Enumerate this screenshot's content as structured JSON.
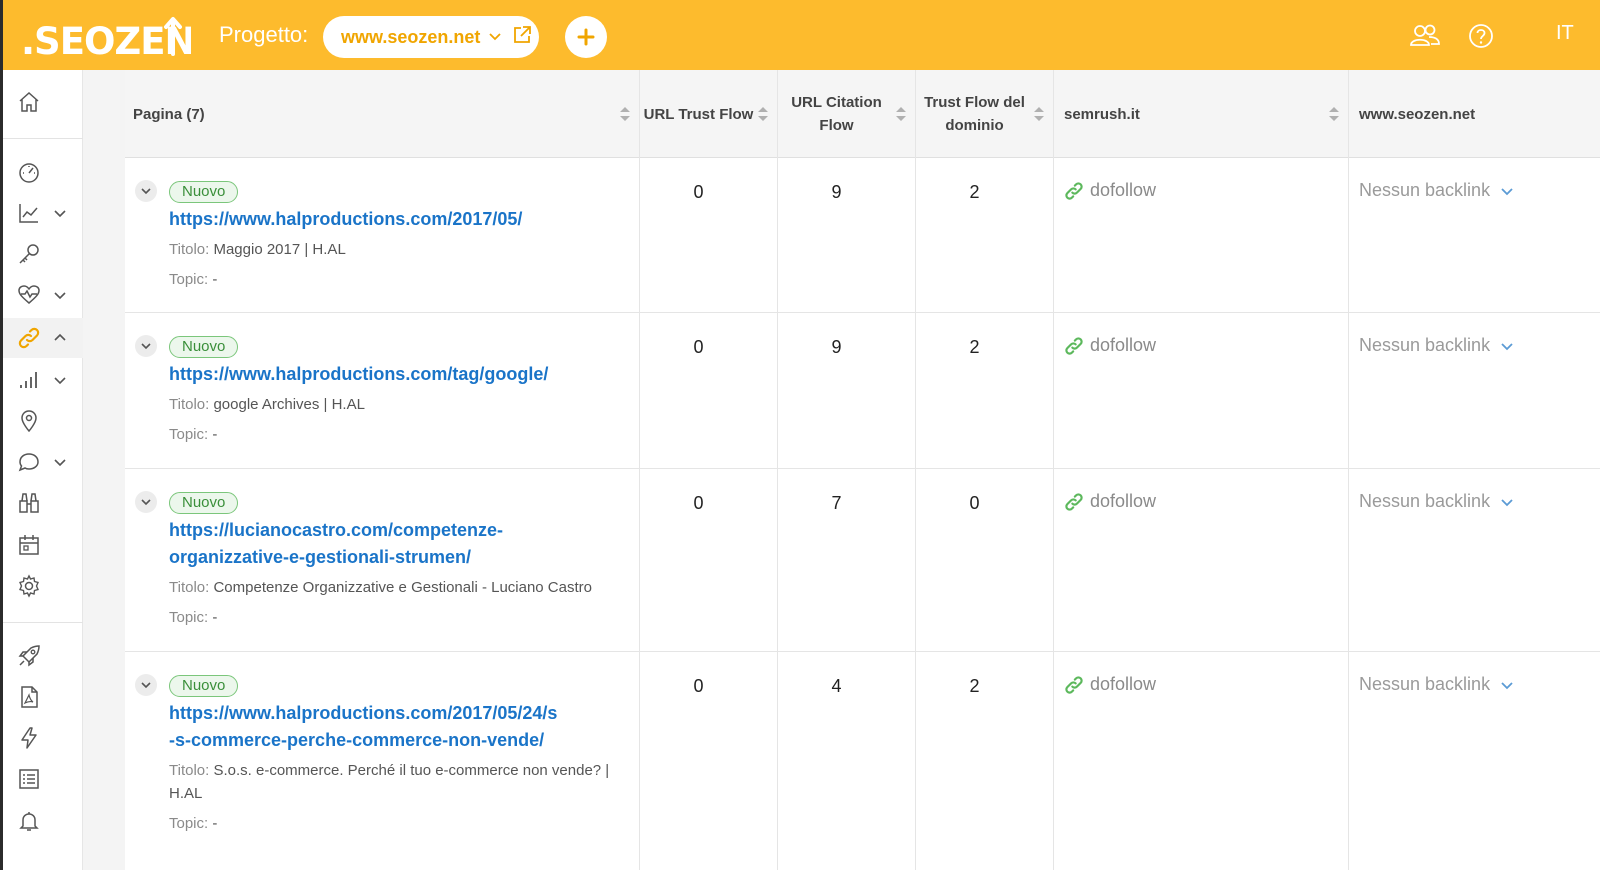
{
  "header": {
    "logo_text": "SEOZEN",
    "project_label": "Progetto:",
    "project_name": "www.seozen.net",
    "language": "IT",
    "brand_color": "#fdbb2d"
  },
  "sidebar": {
    "items": [
      {
        "icon": "home-icon"
      },
      {
        "icon": "dashboard-gauge-icon"
      },
      {
        "icon": "trend-chart-icon",
        "expandable": true
      },
      {
        "icon": "key-icon"
      },
      {
        "icon": "heartbeat-icon",
        "expandable": true
      },
      {
        "icon": "link-icon",
        "expandable": true,
        "active": true
      },
      {
        "icon": "bar-chart-icon",
        "expandable": true
      },
      {
        "icon": "map-pin-icon"
      },
      {
        "icon": "chat-bubble-icon",
        "expandable": true
      },
      {
        "icon": "binoculars-icon"
      },
      {
        "icon": "calendar-icon"
      },
      {
        "icon": "gear-icon"
      },
      {
        "icon": "rocket-icon"
      },
      {
        "icon": "pdf-icon"
      },
      {
        "icon": "lightning-icon"
      },
      {
        "icon": "checklist-icon"
      },
      {
        "icon": "bell-icon"
      }
    ]
  },
  "table": {
    "columns": {
      "pagina": "Pagina (7)",
      "url_trust_flow": "URL Trust Flow",
      "url_citation_flow": "URL Citation Flow",
      "trust_flow_dominio": "Trust Flow del dominio",
      "semrush": "semrush.it",
      "seozen": "www.seozen.net"
    },
    "rows": [
      {
        "badge": "Nuovo",
        "url_line1": "https://www.halproductions.com/2017/05/",
        "url_line2": "",
        "title_key": "Titolo:",
        "title": "Maggio 2017 | H.AL",
        "topic_key": "Topic:",
        "topic": "-",
        "url_tf": "0",
        "url_cf": "9",
        "domain_tf": "2",
        "semrush": "dofollow",
        "seozen": "Nessun backlink"
      },
      {
        "badge": "Nuovo",
        "url_line1": "https://www.halproductions.com/tag/google/",
        "url_line2": "",
        "title_key": "Titolo:",
        "title": "google Archives | H.AL",
        "topic_key": "Topic:",
        "topic": "-",
        "url_tf": "0",
        "url_cf": "9",
        "domain_tf": "2",
        "semrush": "dofollow",
        "seozen": "Nessun backlink"
      },
      {
        "badge": "Nuovo",
        "url_line1": "https://lucianocastro.com/competenze-",
        "url_line2": "organizzative-e-gestionali-strumen/",
        "title_key": "Titolo:",
        "title": "Competenze Organizzative e Gestionali - Luciano Castro",
        "topic_key": "Topic:",
        "topic": "-",
        "url_tf": "0",
        "url_cf": "7",
        "domain_tf": "0",
        "semrush": "dofollow",
        "seozen": "Nessun backlink"
      },
      {
        "badge": "Nuovo",
        "url_line1": "https://www.halproductions.com/2017/05/24/s",
        "url_line2": "-s-commerce-perche-commerce-non-vende/",
        "title_key": "Titolo:",
        "title": "S.o.s. e-commerce. Perché il tuo e-commerce non vende? |",
        "title_line2": "H.AL",
        "topic_key": "Topic:",
        "topic": "-",
        "url_tf": "0",
        "url_cf": "4",
        "domain_tf": "2",
        "semrush": "dofollow",
        "seozen": "Nessun backlink"
      }
    ]
  }
}
